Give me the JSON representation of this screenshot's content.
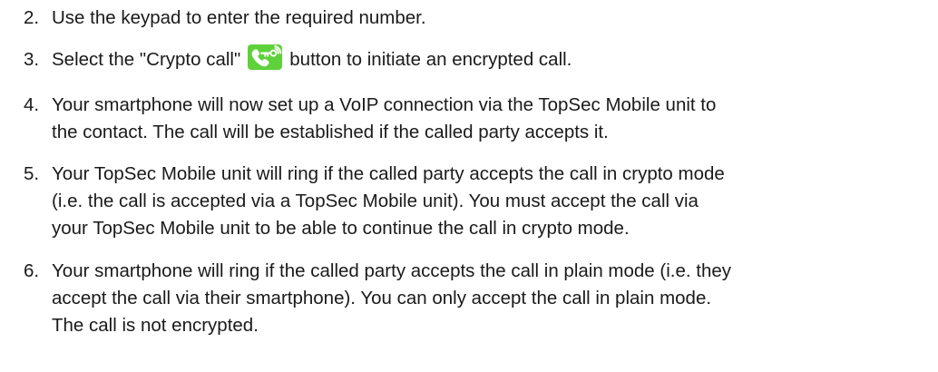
{
  "steps": [
    {
      "number": "2.",
      "lines": [
        "Use the keypad to enter the required number."
      ]
    },
    {
      "number": "3.",
      "before_icon": "Select the \"Crypto call\"",
      "icon": "crypto-call-icon",
      "after_icon": "button to initiate an encrypted call."
    },
    {
      "number": "4.",
      "lines": [
        "Your smartphone will now set up a VoIP connection via the TopSec Mobile unit to",
        "the contact. The call will be established if the called party accepts it."
      ]
    },
    {
      "number": "5.",
      "lines": [
        "Your TopSec Mobile unit will ring if the called party accepts the call in crypto mode",
        "(i.e. the call is accepted via a TopSec Mobile unit). You must accept the call via",
        "your TopSec Mobile unit to be able to continue the call in crypto mode."
      ]
    },
    {
      "number": "6.",
      "lines": [
        "Your smartphone will ring if the called party accepts the call in plain mode (i.e. they",
        "accept the call via their smartphone). You can only accept the call in plain mode.",
        "The call is not encrypted."
      ]
    }
  ],
  "colors": {
    "icon_background": "#5fd13b",
    "icon_foreground": "#ffffff",
    "text": "#1a1a1a"
  }
}
